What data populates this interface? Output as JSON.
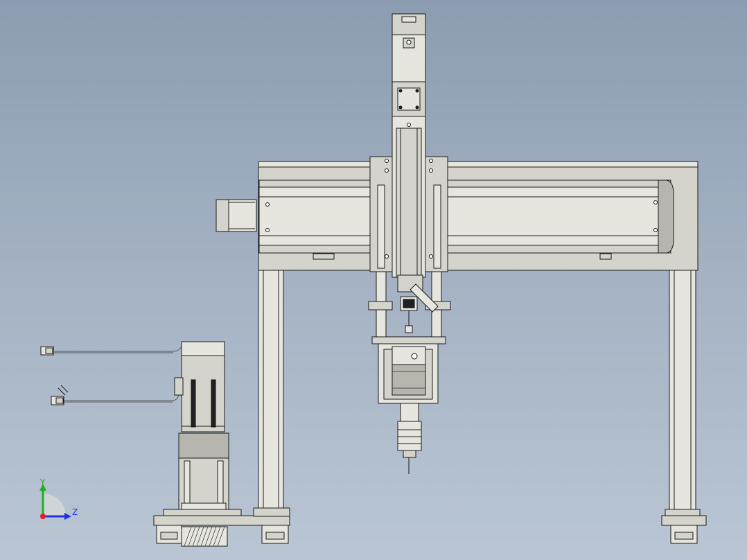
{
  "axis_triad": {
    "y_label": "Y",
    "z_label": "Z",
    "y_color": "#1fb11f",
    "z_color": "#2233dd",
    "x_color": "#dd2222"
  }
}
